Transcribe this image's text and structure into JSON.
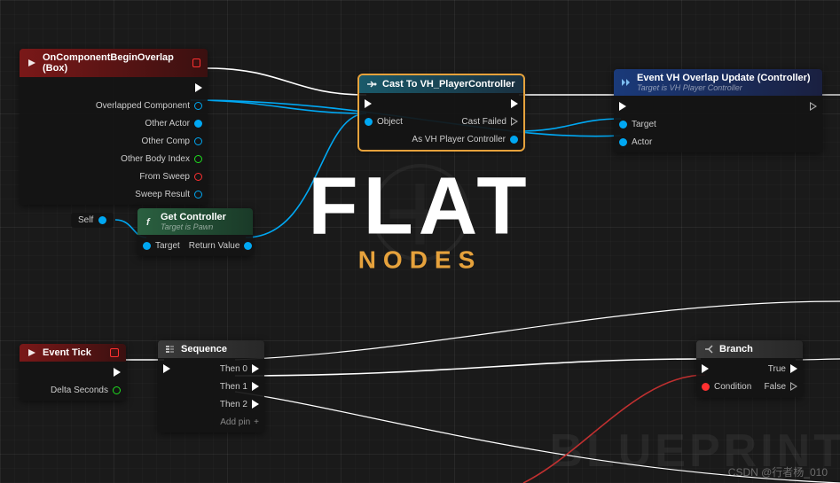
{
  "hero": {
    "main": "FLAT",
    "sub": "NODES"
  },
  "bg": {
    "blueprint": "BLUEPRINT"
  },
  "watermark": "CSDN @行者杨_010",
  "nodes": {
    "overlap": {
      "title": "OnComponentBeginOverlap (Box)",
      "outputs": {
        "overlapped": "Overlapped Component",
        "otheractor": "Other Actor",
        "othercomp": "Other Comp",
        "bodyindex": "Other Body Index",
        "fromsweep": "From Sweep",
        "sweepresult": "Sweep Result"
      }
    },
    "self": {
      "label": "Self"
    },
    "getcontroller": {
      "title": "Get Controller",
      "subtitle": "Target is Pawn",
      "inputs": {
        "target": "Target"
      },
      "outputs": {
        "return": "Return Value"
      }
    },
    "cast": {
      "title": "Cast To VH_PlayerController",
      "inputs": {
        "object": "Object"
      },
      "outputs": {
        "castfailed": "Cast Failed",
        "asctrl": "As VH Player Controller"
      }
    },
    "eventcall": {
      "title": "Event VH Overlap Update (Controller)",
      "subtitle": "Target is VH Player Controller",
      "inputs": {
        "target": "Target",
        "actor": "Actor"
      }
    },
    "tick": {
      "title": "Event Tick",
      "outputs": {
        "delta": "Delta Seconds"
      }
    },
    "sequence": {
      "title": "Sequence",
      "outputs": {
        "then0": "Then 0",
        "then1": "Then 1",
        "then2": "Then 2"
      },
      "addpin": "Add pin"
    },
    "branch": {
      "title": "Branch",
      "inputs": {
        "condition": "Condition"
      },
      "outputs": {
        "true": "True",
        "false": "False"
      }
    }
  }
}
